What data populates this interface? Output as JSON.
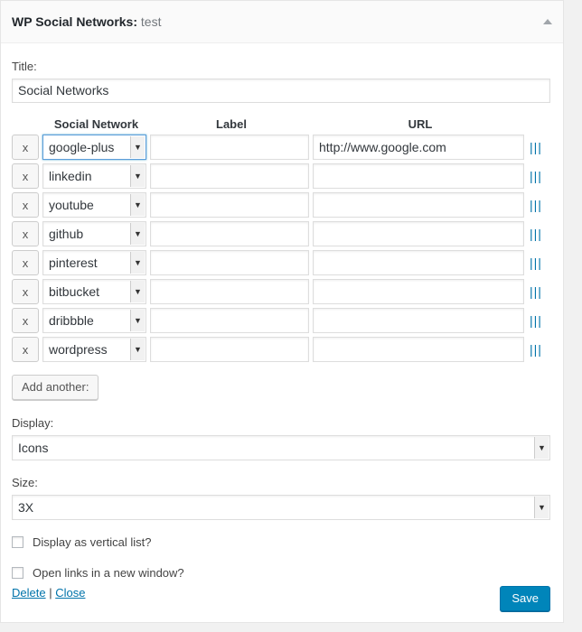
{
  "widget": {
    "title": "WP Social Networks:",
    "instance": "test"
  },
  "title_field": {
    "label": "Title:",
    "value": "Social Networks"
  },
  "table": {
    "headers": {
      "network": "Social Network",
      "label": "Label",
      "url": "URL"
    },
    "remove_label": "x",
    "handle": "|||",
    "rows": [
      {
        "network": "google-plus",
        "label": "",
        "url": "http://www.google.com"
      },
      {
        "network": "linkedin",
        "label": "",
        "url": ""
      },
      {
        "network": "youtube",
        "label": "",
        "url": ""
      },
      {
        "network": "github",
        "label": "",
        "url": ""
      },
      {
        "network": "pinterest",
        "label": "",
        "url": ""
      },
      {
        "network": "bitbucket",
        "label": "",
        "url": ""
      },
      {
        "network": "dribbble",
        "label": "",
        "url": ""
      },
      {
        "network": "wordpress",
        "label": "",
        "url": ""
      }
    ]
  },
  "add_button": "Add another:",
  "display": {
    "label": "Display:",
    "value": "Icons"
  },
  "size": {
    "label": "Size:",
    "value": "3X"
  },
  "options": {
    "vertical": {
      "label": "Display as vertical list?",
      "checked": false
    },
    "new_window": {
      "label": "Open links in a new window?",
      "checked": false
    }
  },
  "controls": {
    "delete": "Delete",
    "separator": "|",
    "close": "Close",
    "save": "Save"
  },
  "colors": {
    "link": "#0073aa",
    "primary": "#0085ba"
  }
}
